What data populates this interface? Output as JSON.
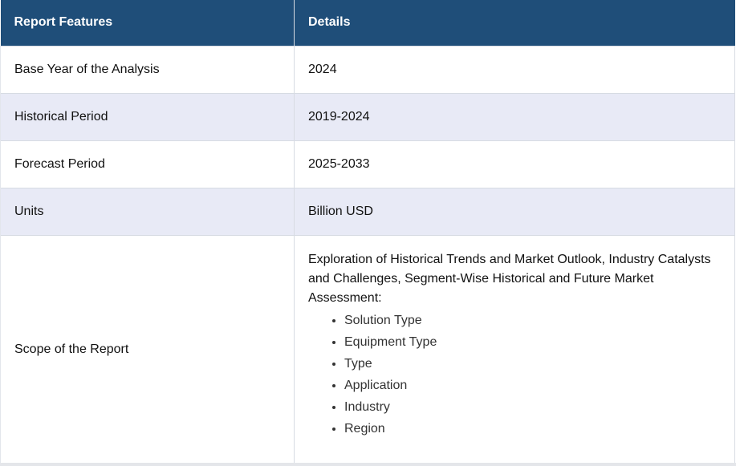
{
  "table": {
    "headers": [
      "Report Features",
      "Details"
    ],
    "rows": [
      {
        "feature": "Base Year of the Analysis",
        "detail": "2024"
      },
      {
        "feature": "Historical Period",
        "detail": "2019-2024"
      },
      {
        "feature": "Forecast Period",
        "detail": "2025-2033"
      },
      {
        "feature": "Units",
        "detail": "Billion USD"
      }
    ],
    "scope": {
      "feature": "Scope of the Report",
      "text": "Exploration of Historical Trends and Market Outlook, Industry Catalysts and Challenges, Segment-Wise Historical and Future Market Assessment:",
      "items": [
        "Solution Type",
        "Equipment Type",
        "Type",
        "Application",
        "Industry",
        "Region"
      ]
    }
  },
  "colors": {
    "header_bg": "#1f4e79",
    "alt_row_bg": "#e8eaf6"
  }
}
